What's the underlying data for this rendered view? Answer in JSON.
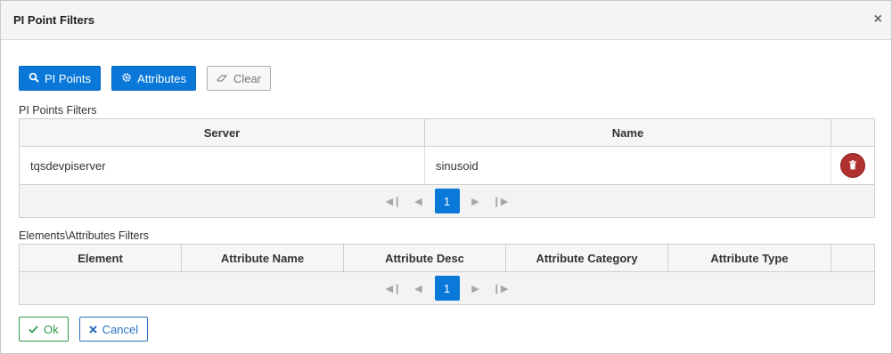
{
  "dialog": {
    "title": "PI Point Filters",
    "close_label": "×"
  },
  "toolbar": {
    "pi_points_label": "PI Points",
    "attributes_label": "Attributes",
    "clear_label": "Clear"
  },
  "pi_points_filters": {
    "label": "PI Points Filters",
    "columns": [
      "Server",
      "Name"
    ],
    "rows": [
      {
        "server": "tqsdevpiserver",
        "name": "sinusoid"
      }
    ],
    "pager": {
      "page": "1"
    }
  },
  "attributes_filters": {
    "label": "Elements\\Attributes Filters",
    "columns": [
      "Element",
      "Attribute Name",
      "Attribute Desc",
      "Attribute Category",
      "Attribute Type"
    ],
    "pager": {
      "page": "1"
    }
  },
  "footer": {
    "ok_label": "Ok",
    "cancel_label": "Cancel"
  },
  "colors": {
    "primary": "#0a78d8",
    "danger": "#b0312f",
    "ok": "#2e9a4a",
    "cancel": "#2a6fbf"
  }
}
